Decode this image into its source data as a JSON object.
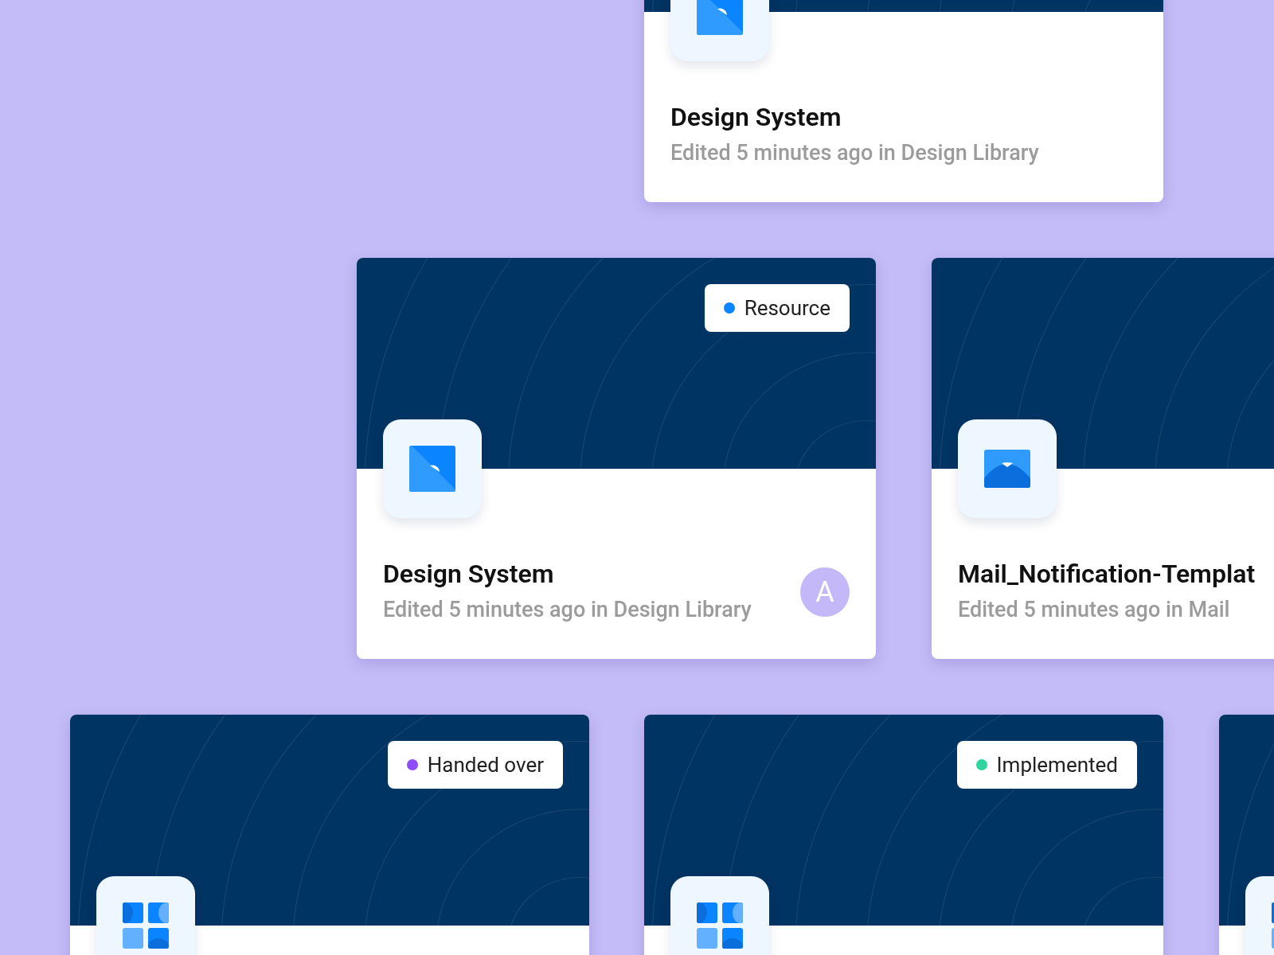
{
  "cards": [
    {
      "kind": "image",
      "title": "Design System",
      "subtitle": "Edited 5 minutes ago in Design Library"
    },
    {
      "kind": "image",
      "status": {
        "label": "Resource",
        "color": "#0a84ff"
      },
      "title": "Design System",
      "subtitle": "Edited 5 minutes ago in Design Library",
      "avatar": "A"
    },
    {
      "kind": "mail",
      "title": "Mail_Notification-Templat",
      "subtitle": "Edited 5 minutes ago in Mail"
    },
    {
      "kind": "grid",
      "status": {
        "label": "Handed over",
        "color": "#8e4dfa"
      }
    },
    {
      "kind": "grid",
      "status": {
        "label": "Implemented",
        "color": "#2fd59a"
      }
    },
    {
      "kind": "grid"
    }
  ]
}
